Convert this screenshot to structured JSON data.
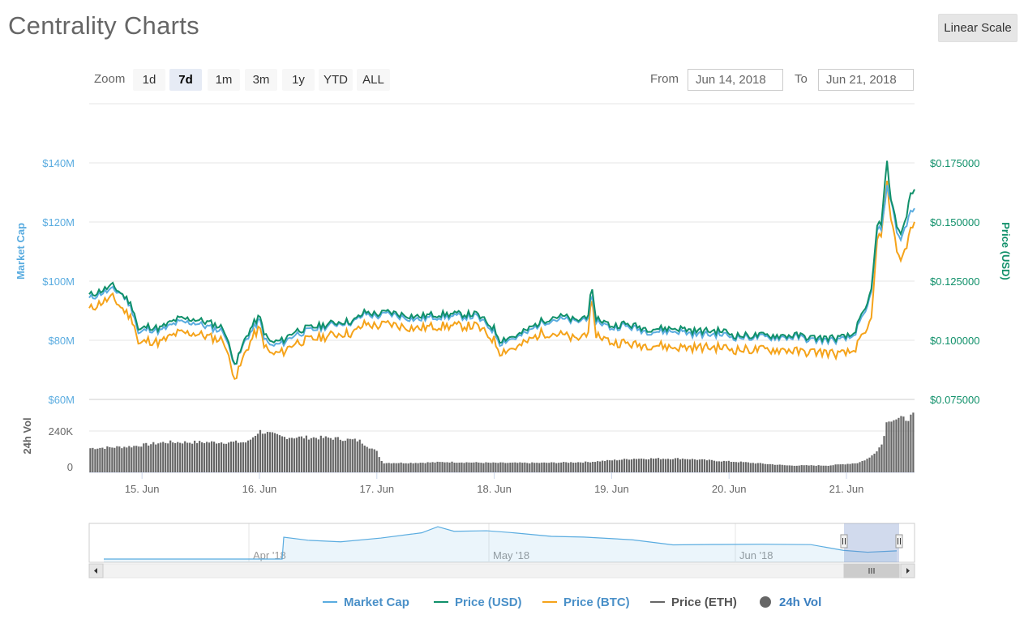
{
  "header": {
    "title": "Centrality Charts",
    "scale_button": "Linear Scale"
  },
  "zoom": {
    "label": "Zoom",
    "buttons": [
      {
        "label": "1d",
        "active": false
      },
      {
        "label": "7d",
        "active": true
      },
      {
        "label": "1m",
        "active": false
      },
      {
        "label": "3m",
        "active": false
      },
      {
        "label": "1y",
        "active": false
      },
      {
        "label": "YTD",
        "active": false
      },
      {
        "label": "ALL",
        "active": false
      }
    ]
  },
  "range": {
    "from_label": "From",
    "from_value": "Jun 14, 2018",
    "to_label": "To",
    "to_value": "Jun 21, 2018"
  },
  "colors": {
    "market_cap": "#5aace0",
    "price_usd": "#10906a",
    "price_btc": "#f5a31a",
    "price_eth": "#666666",
    "vol": "#666666"
  },
  "chart_data": {
    "type": "line",
    "x_tick_labels": [
      "15. Jun",
      "16. Jun",
      "17. Jun",
      "18. Jun",
      "19. Jun",
      "20. Jun",
      "21. Jun"
    ],
    "x_start_day": 14.55,
    "x_end_day": 21.58,
    "left_axis": {
      "title": "Market Cap",
      "ticks": [
        "$60M",
        "$80M",
        "$100M",
        "$120M",
        "$140M"
      ],
      "range": [
        60,
        140
      ]
    },
    "right_axis": {
      "title": "Price (USD)",
      "ticks": [
        "$0.075000",
        "$0.100000",
        "$0.125000",
        "$0.150000",
        "$0.175000"
      ],
      "range": [
        0.075,
        0.175
      ]
    },
    "vol_axis": {
      "title": "24h Vol",
      "ticks": [
        "0",
        "240K"
      ],
      "range": [
        0,
        400
      ]
    },
    "series": [
      {
        "name": "Market Cap",
        "values": [
          [
            14.55,
            94
          ],
          [
            14.65,
            96
          ],
          [
            14.75,
            97
          ],
          [
            14.82,
            96
          ],
          [
            14.88,
            93
          ],
          [
            14.93,
            89
          ],
          [
            14.97,
            82
          ],
          [
            15.05,
            84
          ],
          [
            15.15,
            83
          ],
          [
            15.3,
            86
          ],
          [
            15.45,
            86
          ],
          [
            15.6,
            84
          ],
          [
            15.7,
            83
          ],
          [
            15.75,
            76
          ],
          [
            15.8,
            72
          ],
          [
            15.88,
            80
          ],
          [
            15.95,
            84
          ],
          [
            16.0,
            87
          ],
          [
            16.05,
            80
          ],
          [
            16.1,
            78
          ],
          [
            16.2,
            79
          ],
          [
            16.3,
            82
          ],
          [
            16.4,
            83
          ],
          [
            16.5,
            84
          ],
          [
            16.6,
            85
          ],
          [
            16.7,
            86
          ],
          [
            16.8,
            86
          ],
          [
            16.9,
            89
          ],
          [
            17.0,
            88
          ],
          [
            17.1,
            89
          ],
          [
            17.2,
            88
          ],
          [
            17.35,
            87
          ],
          [
            17.5,
            88
          ],
          [
            17.7,
            88
          ],
          [
            17.85,
            88
          ],
          [
            18.0,
            83
          ],
          [
            18.05,
            79
          ],
          [
            18.1,
            80
          ],
          [
            18.2,
            81
          ],
          [
            18.3,
            83
          ],
          [
            18.4,
            86
          ],
          [
            18.5,
            87
          ],
          [
            18.6,
            87
          ],
          [
            18.7,
            86
          ],
          [
            18.8,
            88
          ],
          [
            18.83,
            95
          ],
          [
            18.86,
            87
          ],
          [
            19.0,
            84
          ],
          [
            19.1,
            85
          ],
          [
            19.2,
            84
          ],
          [
            19.3,
            83
          ],
          [
            19.4,
            83
          ],
          [
            19.5,
            83
          ],
          [
            19.6,
            83
          ],
          [
            19.7,
            82
          ],
          [
            19.8,
            82
          ],
          [
            19.95,
            82
          ],
          [
            20.05,
            81
          ],
          [
            20.2,
            81
          ],
          [
            20.4,
            81
          ],
          [
            20.5,
            81
          ],
          [
            20.6,
            81
          ],
          [
            20.7,
            80
          ],
          [
            20.8,
            80
          ],
          [
            20.95,
            80
          ],
          [
            21.05,
            81
          ],
          [
            21.12,
            86
          ],
          [
            21.18,
            91
          ],
          [
            21.22,
            99
          ],
          [
            21.27,
            120
          ],
          [
            21.3,
            116
          ],
          [
            21.34,
            132
          ],
          [
            21.38,
            128
          ],
          [
            21.42,
            118
          ],
          [
            21.46,
            114
          ],
          [
            21.5,
            118
          ],
          [
            21.54,
            123
          ],
          [
            21.58,
            124
          ]
        ]
      },
      {
        "name": "Price (USD)",
        "values": [
          [
            14.55,
            0.119
          ],
          [
            14.65,
            0.121
          ],
          [
            14.75,
            0.123
          ],
          [
            14.82,
            0.12
          ],
          [
            14.88,
            0.117
          ],
          [
            14.93,
            0.113
          ],
          [
            14.97,
            0.104
          ],
          [
            15.05,
            0.106
          ],
          [
            15.15,
            0.105
          ],
          [
            15.3,
            0.109
          ],
          [
            15.45,
            0.109
          ],
          [
            15.6,
            0.107
          ],
          [
            15.7,
            0.105
          ],
          [
            15.75,
            0.096
          ],
          [
            15.8,
            0.09
          ],
          [
            15.88,
            0.101
          ],
          [
            15.95,
            0.107
          ],
          [
            16.0,
            0.11
          ],
          [
            16.05,
            0.102
          ],
          [
            16.1,
            0.099
          ],
          [
            16.2,
            0.1
          ],
          [
            16.3,
            0.104
          ],
          [
            16.4,
            0.105
          ],
          [
            16.5,
            0.106
          ],
          [
            16.6,
            0.107
          ],
          [
            16.7,
            0.108
          ],
          [
            16.8,
            0.108
          ],
          [
            16.9,
            0.112
          ],
          [
            17.0,
            0.111
          ],
          [
            17.1,
            0.112
          ],
          [
            17.2,
            0.111
          ],
          [
            17.35,
            0.11
          ],
          [
            17.5,
            0.111
          ],
          [
            17.7,
            0.111
          ],
          [
            17.85,
            0.111
          ],
          [
            18.0,
            0.105
          ],
          [
            18.05,
            0.1
          ],
          [
            18.1,
            0.101
          ],
          [
            18.2,
            0.102
          ],
          [
            18.3,
            0.105
          ],
          [
            18.4,
            0.108
          ],
          [
            18.5,
            0.11
          ],
          [
            18.6,
            0.11
          ],
          [
            18.7,
            0.108
          ],
          [
            18.8,
            0.111
          ],
          [
            18.83,
            0.122
          ],
          [
            18.86,
            0.11
          ],
          [
            19.0,
            0.106
          ],
          [
            19.1,
            0.107
          ],
          [
            19.2,
            0.106
          ],
          [
            19.3,
            0.105
          ],
          [
            19.4,
            0.105
          ],
          [
            19.5,
            0.105
          ],
          [
            19.6,
            0.105
          ],
          [
            19.7,
            0.104
          ],
          [
            19.8,
            0.104
          ],
          [
            19.95,
            0.104
          ],
          [
            20.05,
            0.102
          ],
          [
            20.2,
            0.102
          ],
          [
            20.4,
            0.102
          ],
          [
            20.5,
            0.102
          ],
          [
            20.6,
            0.102
          ],
          [
            20.7,
            0.101
          ],
          [
            20.8,
            0.101
          ],
          [
            20.95,
            0.101
          ],
          [
            21.05,
            0.102
          ],
          [
            21.12,
            0.109
          ],
          [
            21.18,
            0.115
          ],
          [
            21.22,
            0.125
          ],
          [
            21.27,
            0.152
          ],
          [
            21.3,
            0.147
          ],
          [
            21.34,
            0.177
          ],
          [
            21.38,
            0.16
          ],
          [
            21.42,
            0.15
          ],
          [
            21.46,
            0.145
          ],
          [
            21.5,
            0.15
          ],
          [
            21.54,
            0.161
          ],
          [
            21.58,
            0.163
          ]
        ]
      },
      {
        "name": "Price (BTC)",
        "values": [
          [
            14.55,
            0.113
          ],
          [
            14.65,
            0.116
          ],
          [
            14.75,
            0.118
          ],
          [
            14.82,
            0.114
          ],
          [
            14.88,
            0.111
          ],
          [
            14.93,
            0.108
          ],
          [
            14.97,
            0.098
          ],
          [
            15.05,
            0.1
          ],
          [
            15.15,
            0.099
          ],
          [
            15.3,
            0.103
          ],
          [
            15.45,
            0.103
          ],
          [
            15.6,
            0.101
          ],
          [
            15.7,
            0.1
          ],
          [
            15.75,
            0.09
          ],
          [
            15.8,
            0.084
          ],
          [
            15.88,
            0.095
          ],
          [
            15.95,
            0.102
          ],
          [
            16.0,
            0.105
          ],
          [
            16.05,
            0.097
          ],
          [
            16.1,
            0.094
          ],
          [
            16.2,
            0.095
          ],
          [
            16.3,
            0.099
          ],
          [
            16.4,
            0.1
          ],
          [
            16.5,
            0.101
          ],
          [
            16.6,
            0.102
          ],
          [
            16.7,
            0.103
          ],
          [
            16.8,
            0.103
          ],
          [
            16.9,
            0.107
          ],
          [
            17.0,
            0.106
          ],
          [
            17.1,
            0.107
          ],
          [
            17.2,
            0.106
          ],
          [
            17.35,
            0.105
          ],
          [
            17.5,
            0.106
          ],
          [
            17.7,
            0.106
          ],
          [
            17.85,
            0.106
          ],
          [
            18.0,
            0.1
          ],
          [
            18.05,
            0.095
          ],
          [
            18.1,
            0.096
          ],
          [
            18.2,
            0.097
          ],
          [
            18.3,
            0.1
          ],
          [
            18.4,
            0.103
          ],
          [
            18.5,
            0.103
          ],
          [
            18.6,
            0.102
          ],
          [
            18.7,
            0.1
          ],
          [
            18.8,
            0.104
          ],
          [
            18.83,
            0.117
          ],
          [
            18.86,
            0.103
          ],
          [
            19.0,
            0.099
          ],
          [
            19.1,
            0.099
          ],
          [
            19.2,
            0.098
          ],
          [
            19.3,
            0.098
          ],
          [
            19.4,
            0.098
          ],
          [
            19.5,
            0.097
          ],
          [
            19.6,
            0.097
          ],
          [
            19.7,
            0.097
          ],
          [
            19.8,
            0.097
          ],
          [
            19.95,
            0.097
          ],
          [
            20.05,
            0.096
          ],
          [
            20.2,
            0.096
          ],
          [
            20.4,
            0.096
          ],
          [
            20.5,
            0.096
          ],
          [
            20.6,
            0.095
          ],
          [
            20.7,
            0.095
          ],
          [
            20.8,
            0.095
          ],
          [
            20.95,
            0.094
          ],
          [
            21.05,
            0.095
          ],
          [
            21.12,
            0.1
          ],
          [
            21.18,
            0.104
          ],
          [
            21.22,
            0.113
          ],
          [
            21.27,
            0.147
          ],
          [
            21.3,
            0.142
          ],
          [
            21.34,
            0.168
          ],
          [
            21.38,
            0.152
          ],
          [
            21.42,
            0.14
          ],
          [
            21.46,
            0.134
          ],
          [
            21.5,
            0.138
          ],
          [
            21.54,
            0.146
          ],
          [
            21.58,
            0.149
          ]
        ]
      },
      {
        "name": "24h Vol",
        "values": [
          [
            14.55,
            140
          ],
          [
            14.9,
            150
          ],
          [
            15.2,
            175
          ],
          [
            15.6,
            175
          ],
          [
            15.9,
            175
          ],
          [
            16.0,
            240
          ],
          [
            16.2,
            205
          ],
          [
            16.6,
            200
          ],
          [
            16.85,
            185
          ],
          [
            17.0,
            120
          ],
          [
            17.05,
            55
          ],
          [
            17.3,
            55
          ],
          [
            17.6,
            60
          ],
          [
            18.0,
            55
          ],
          [
            18.4,
            55
          ],
          [
            18.8,
            60
          ],
          [
            19.2,
            80
          ],
          [
            19.6,
            80
          ],
          [
            19.95,
            65
          ],
          [
            20.1,
            60
          ],
          [
            20.5,
            40
          ],
          [
            20.85,
            40
          ],
          [
            21.1,
            55
          ],
          [
            21.2,
            85
          ],
          [
            21.3,
            160
          ],
          [
            21.35,
            310
          ],
          [
            21.5,
            310
          ],
          [
            21.58,
            330
          ]
        ]
      }
    ]
  },
  "navigator": {
    "labels": [
      "Apr '18",
      "May '18",
      "Jun '18"
    ],
    "selection_start": 0.91,
    "selection_end": 0.985
  },
  "legend": [
    {
      "name": "Market Cap",
      "color": "#5aace0",
      "kind": "line"
    },
    {
      "name": "Price (USD)",
      "color": "#10906a",
      "kind": "line"
    },
    {
      "name": "Price (BTC)",
      "color": "#f5a31a",
      "kind": "line"
    },
    {
      "name": "Price (ETH)",
      "color": "#666666",
      "kind": "line"
    },
    {
      "name": "24h Vol",
      "color": "#666666",
      "kind": "dot"
    }
  ]
}
